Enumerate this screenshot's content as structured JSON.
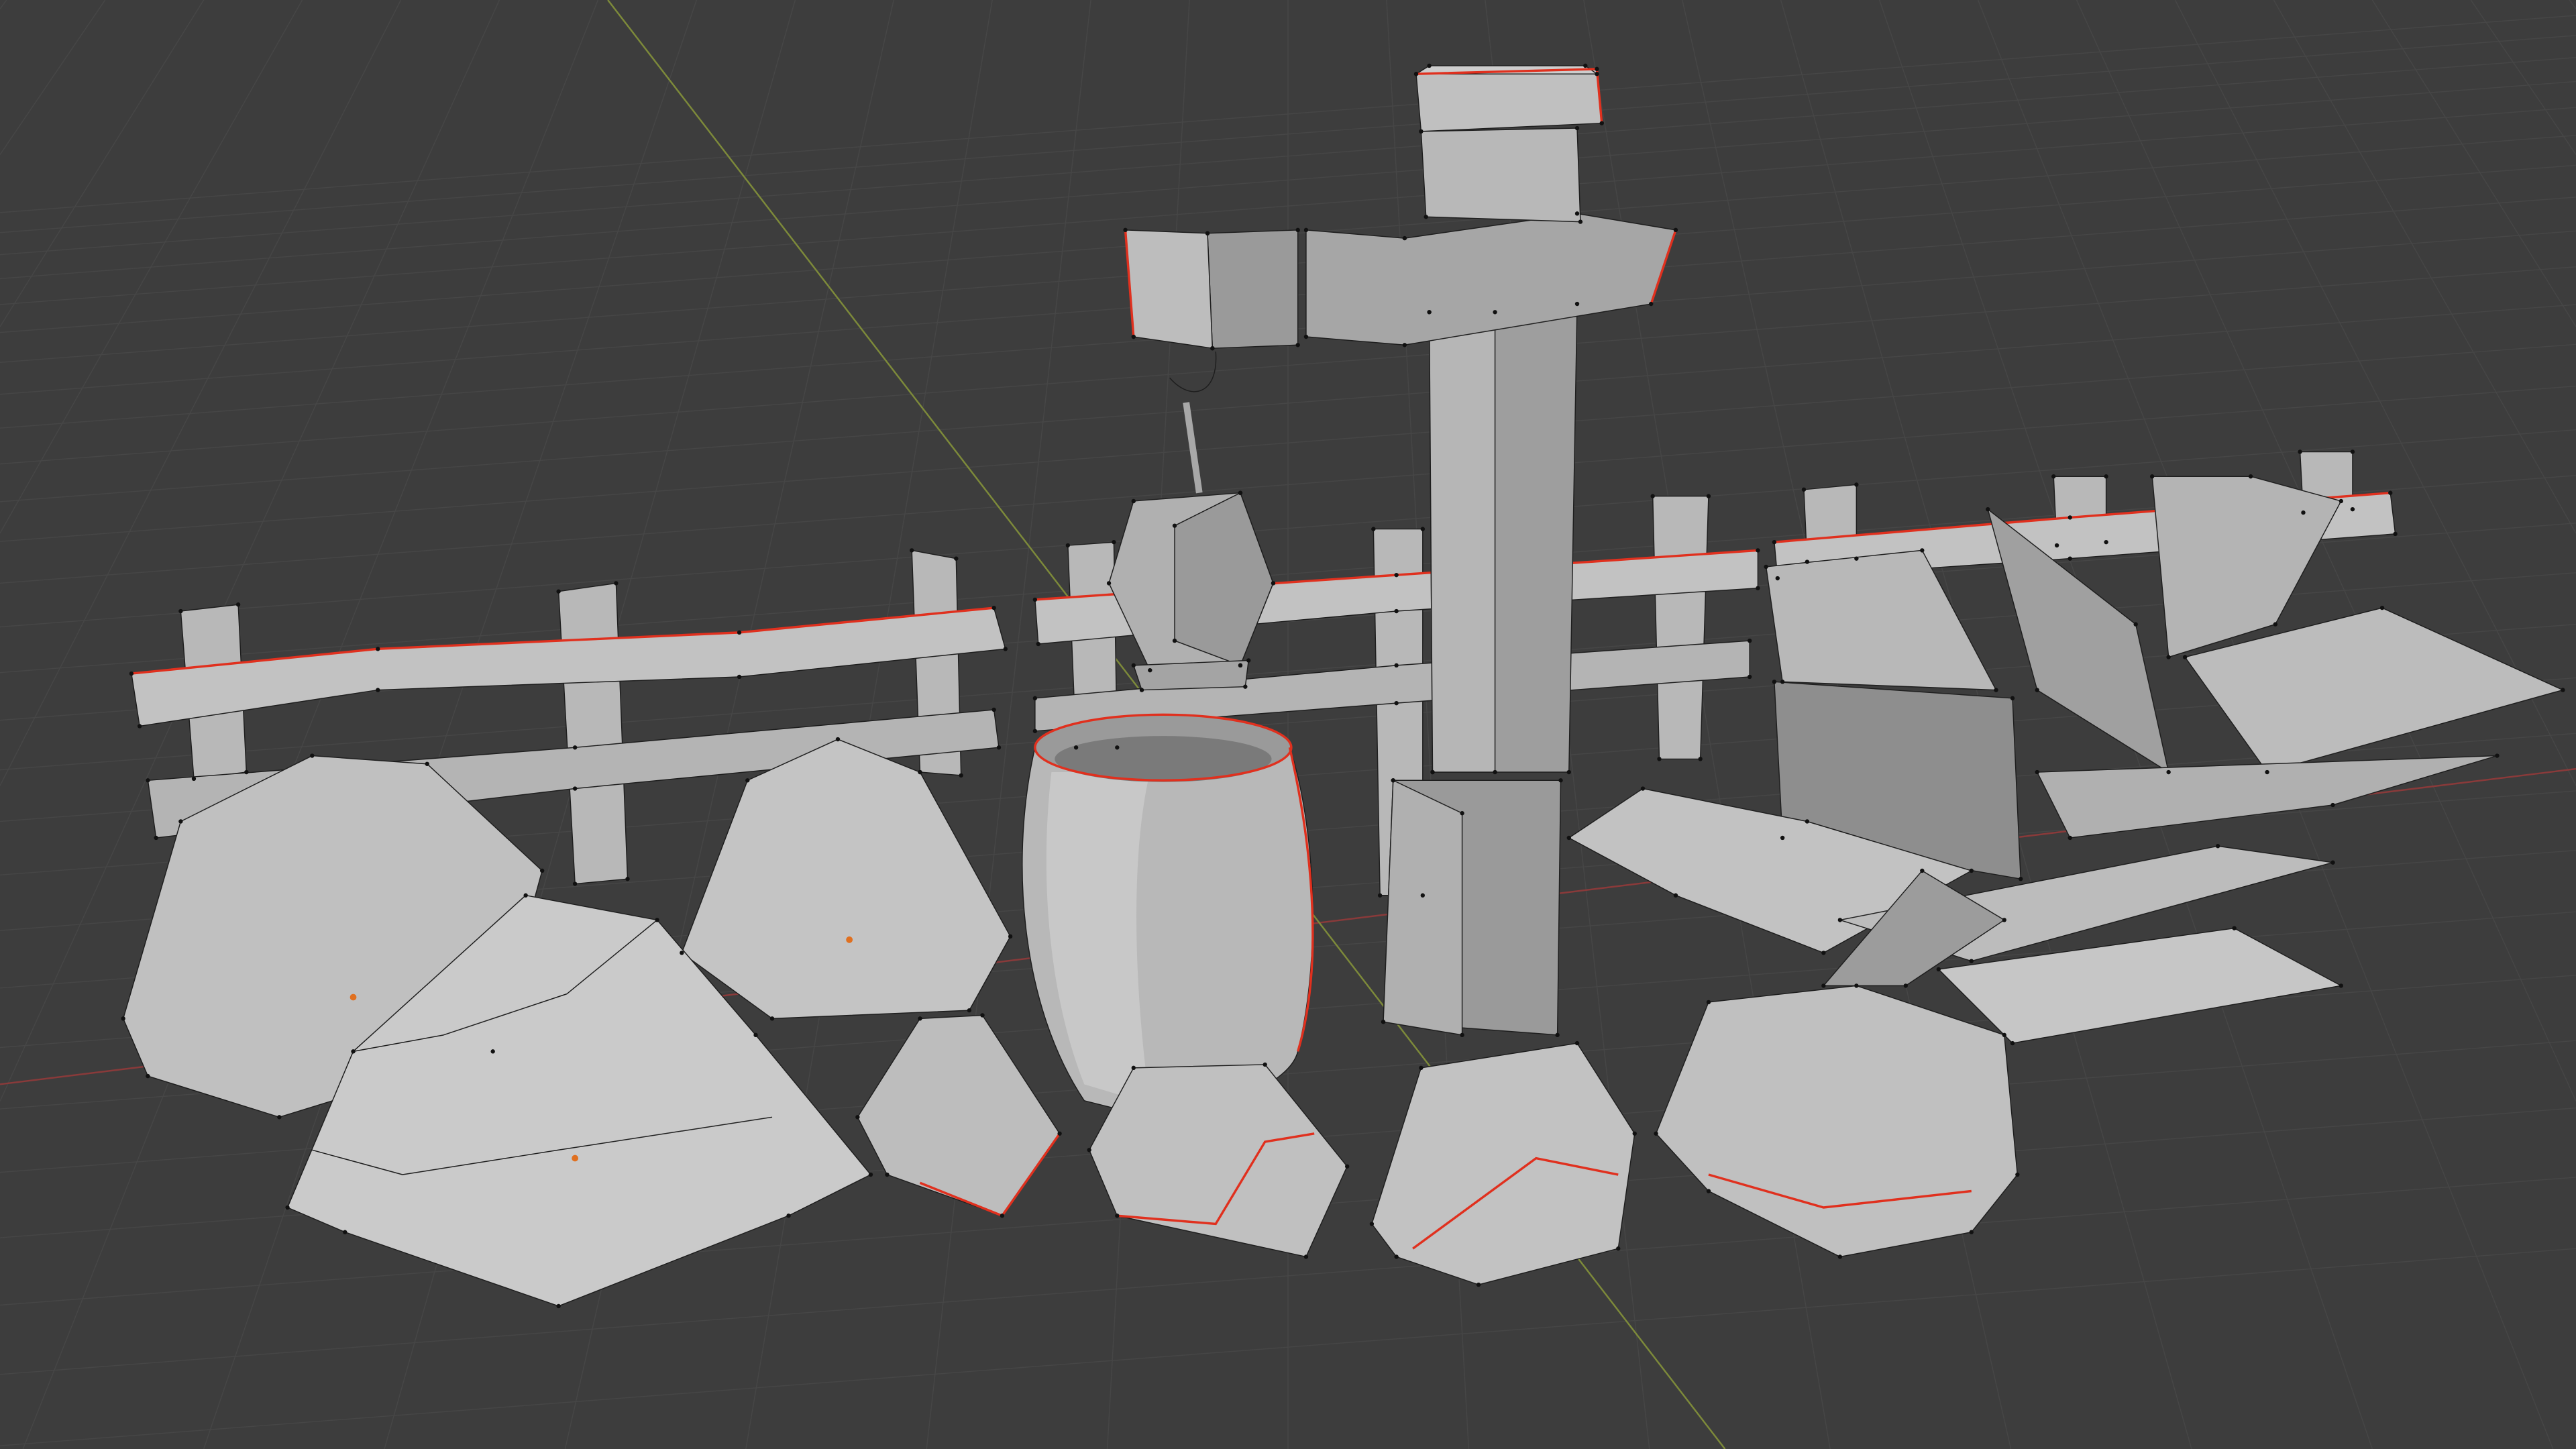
{
  "viewport": {
    "background_color": "#3d3d3d",
    "grid_color": "#464646",
    "x_axis_color": "#8a3a3a",
    "y_axis_color": "#7d8a3a",
    "mesh_light": "#c4c4c4",
    "mesh_mid": "#a8a8a8",
    "mesh_dark": "#8a8a8a",
    "seam_color": "#e0301e",
    "origin_color": "#e07020"
  }
}
